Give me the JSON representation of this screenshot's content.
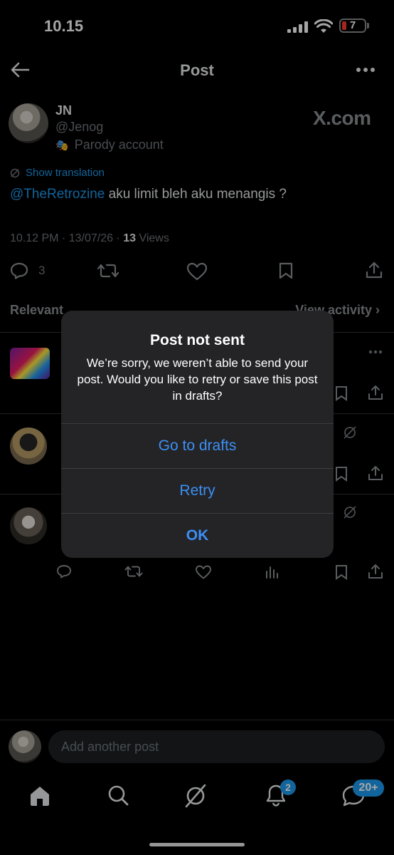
{
  "status_bar": {
    "time": "10.15",
    "battery": "7"
  },
  "header": {
    "title": "Post"
  },
  "tweet": {
    "name": "JN",
    "handle": "@Jenog",
    "label": "Parody account",
    "watermark": "X.com",
    "show_translation": "Show translation",
    "mention": "@TheRetrozine",
    "text": " aku limit bleh aku menangis ?",
    "time": "10.12 PM · 13/07/26 · ",
    "views_count": "13",
    "views_label": " Views",
    "reply_count": "3"
  },
  "replies_bar": {
    "sort": "Relevant",
    "view_activity": "View activity"
  },
  "dialog": {
    "title": "Post not sent",
    "message": "We’re sorry, we weren’t able to send your post. Would you like to retry or save this post in drafts?",
    "go_to_drafts": "Go to drafts",
    "retry": "Retry",
    "ok": "OK"
  },
  "compose": {
    "placeholder": "Add another post"
  },
  "tab_bar": {
    "notifications_badge": "2",
    "messages_badge": "20+"
  },
  "colors": {
    "accent": "#1d9bf0",
    "dialog_button": "#3c8ff5",
    "background": "#000000"
  }
}
